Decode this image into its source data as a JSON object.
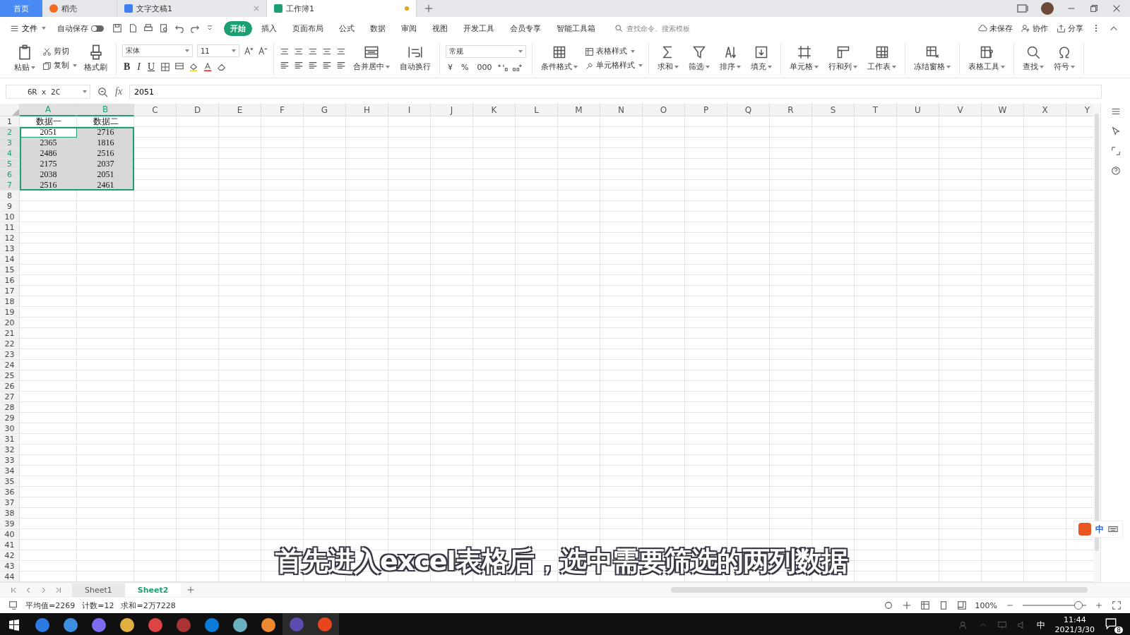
{
  "tabs": [
    {
      "kind": "home",
      "label": "首页",
      "selected": false
    },
    {
      "kind": "docer",
      "label": "稻壳",
      "selected": false
    },
    {
      "kind": "writer",
      "label": "文字文稿1",
      "selected": false,
      "modified": false
    },
    {
      "kind": "sheet",
      "label": "工作簿1",
      "selected": true,
      "modified": true
    }
  ],
  "menu": {
    "file": "文件",
    "autosave": {
      "label": "自动保存",
      "on": false
    },
    "items": [
      {
        "label": "开始",
        "selected": true
      },
      {
        "label": "插入",
        "selected": false
      },
      {
        "label": "页面布局",
        "selected": false
      },
      {
        "label": "公式",
        "selected": false
      },
      {
        "label": "数据",
        "selected": false
      },
      {
        "label": "审阅",
        "selected": false
      },
      {
        "label": "视图",
        "selected": false
      },
      {
        "label": "开发工具",
        "selected": false
      },
      {
        "label": "会员专享",
        "selected": false
      },
      {
        "label": "智能工具箱",
        "selected": false
      }
    ],
    "search": {
      "placeholder": "查找命令、搜索模板"
    },
    "actions": [
      "未保存",
      "协作",
      "分享"
    ]
  },
  "ribbon": [
    {
      "kind": "clipboard",
      "paste": "粘贴",
      "cut": "剪切",
      "copy": "复制",
      "painter": "格式刷"
    },
    {
      "kind": "font",
      "font": "宋体",
      "size": "11",
      "styles": [
        "B",
        "I",
        "U"
      ]
    },
    {
      "kind": "align",
      "merge": "合并居中",
      "wrap": "自动换行"
    },
    {
      "kind": "number",
      "format": "常规",
      "symbols": [
        "¥",
        "%",
        "000"
      ]
    },
    {
      "kind": "styles",
      "conditional": "条件格式",
      "table_style": "表格样式",
      "cell_style": "单元格样式"
    },
    {
      "kind": "tools",
      "buttons": [
        "求和",
        "筛选",
        "排序",
        "填充"
      ]
    },
    {
      "kind": "tools",
      "buttons": [
        "单元格",
        "行和列",
        "工作表"
      ]
    },
    {
      "kind": "tools",
      "buttons": [
        "冻结窗格"
      ]
    },
    {
      "kind": "tools",
      "buttons": [
        "表格工具"
      ]
    },
    {
      "kind": "tools",
      "buttons": [
        "查找",
        "符号"
      ]
    }
  ],
  "formula_bar": {
    "name_box": "6R x 2C",
    "fx": "fx",
    "value": "2051"
  },
  "sheet": {
    "columns": [
      {
        "label": "A",
        "selected": true
      },
      {
        "label": "B",
        "selected": true
      },
      {
        "label": "C",
        "selected": false
      },
      {
        "label": "D",
        "selected": false
      },
      {
        "label": "E",
        "selected": false
      },
      {
        "label": "F",
        "selected": false
      },
      {
        "label": "G",
        "selected": false
      },
      {
        "label": "H",
        "selected": false
      },
      {
        "label": "I",
        "selected": false
      },
      {
        "label": "J",
        "selected": false
      },
      {
        "label": "K",
        "selected": false
      },
      {
        "label": "L",
        "selected": false
      },
      {
        "label": "M",
        "selected": false
      },
      {
        "label": "N",
        "selected": false
      },
      {
        "label": "O",
        "selected": false
      },
      {
        "label": "P",
        "selected": false
      },
      {
        "label": "Q",
        "selected": false
      },
      {
        "label": "R",
        "selected": false
      },
      {
        "label": "S",
        "selected": false
      },
      {
        "label": "T",
        "selected": false
      },
      {
        "label": "U",
        "selected": false
      },
      {
        "label": "V",
        "selected": false
      },
      {
        "label": "W",
        "selected": false
      },
      {
        "label": "X",
        "selected": false
      },
      {
        "label": "Y",
        "selected": false
      }
    ],
    "rows": [
      {
        "number": "1",
        "selected": false,
        "cells": [
          {
            "text": "数据一",
            "active": false
          },
          {
            "text": "数据二",
            "active": false
          }
        ]
      },
      {
        "number": "2",
        "selected": true,
        "cells": [
          {
            "text": "2051",
            "active": true
          },
          {
            "text": "2716",
            "active": false
          }
        ]
      },
      {
        "number": "3",
        "selected": true,
        "cells": [
          {
            "text": "2365",
            "active": false
          },
          {
            "text": "1816",
            "active": false
          }
        ]
      },
      {
        "number": "4",
        "selected": true,
        "cells": [
          {
            "text": "2486",
            "active": false
          },
          {
            "text": "2516",
            "active": false
          }
        ]
      },
      {
        "number": "5",
        "selected": true,
        "cells": [
          {
            "text": "2175",
            "active": false
          },
          {
            "text": "2037",
            "active": false
          }
        ]
      },
      {
        "number": "6",
        "selected": true,
        "cells": [
          {
            "text": "2038",
            "active": false
          },
          {
            "text": "2051",
            "active": false
          }
        ]
      },
      {
        "number": "7",
        "selected": true,
        "cells": [
          {
            "text": "2516",
            "active": false
          },
          {
            "text": "2461",
            "active": false
          }
        ]
      },
      {
        "number": "8",
        "selected": false
      },
      {
        "number": "9",
        "selected": false
      },
      {
        "number": "10",
        "selected": false
      },
      {
        "number": "11",
        "selected": false
      },
      {
        "number": "12",
        "selected": false
      },
      {
        "number": "13",
        "selected": false
      },
      {
        "number": "14",
        "selected": false
      },
      {
        "number": "15",
        "selected": false
      },
      {
        "number": "16",
        "selected": false
      },
      {
        "number": "17",
        "selected": false
      },
      {
        "number": "18",
        "selected": false
      },
      {
        "number": "19",
        "selected": false
      },
      {
        "number": "20",
        "selected": false
      },
      {
        "number": "21",
        "selected": false
      },
      {
        "number": "22",
        "selected": false
      },
      {
        "number": "23",
        "selected": false
      },
      {
        "number": "24",
        "selected": false
      },
      {
        "number": "25",
        "selected": false
      },
      {
        "number": "26",
        "selected": false
      },
      {
        "number": "27",
        "selected": false
      },
      {
        "number": "28",
        "selected": false
      },
      {
        "number": "29",
        "selected": false
      },
      {
        "number": "30",
        "selected": false
      },
      {
        "number": "31",
        "selected": false
      },
      {
        "number": "32",
        "selected": false
      },
      {
        "number": "33",
        "selected": false
      },
      {
        "number": "34",
        "selected": false
      },
      {
        "number": "35",
        "selected": false
      },
      {
        "number": "36",
        "selected": false
      },
      {
        "number": "37",
        "selected": false
      },
      {
        "number": "38",
        "selected": false
      },
      {
        "number": "39",
        "selected": false
      },
      {
        "number": "40",
        "selected": false
      },
      {
        "number": "41",
        "selected": false
      },
      {
        "number": "42",
        "selected": false
      },
      {
        "number": "43",
        "selected": false
      },
      {
        "number": "44",
        "selected": false
      }
    ]
  },
  "caption": "首先进入excel表格后，选中需要筛选的两列数据",
  "ime_toolbar": {
    "mode": "中"
  },
  "sheet_tabs": [
    {
      "label": "Sheet1",
      "selected": false
    },
    {
      "label": "Sheet2",
      "selected": true
    }
  ],
  "status_bar": {
    "stats": [
      "平均值=2269",
      "计数=12",
      "求和=2万7228"
    ],
    "zoom": "100%",
    "zoom_slider": {
      "level": 0.88
    }
  },
  "taskbar": {
    "ime": "中",
    "time": "11:44",
    "date": "2021/3/30",
    "notifications": "8"
  }
}
